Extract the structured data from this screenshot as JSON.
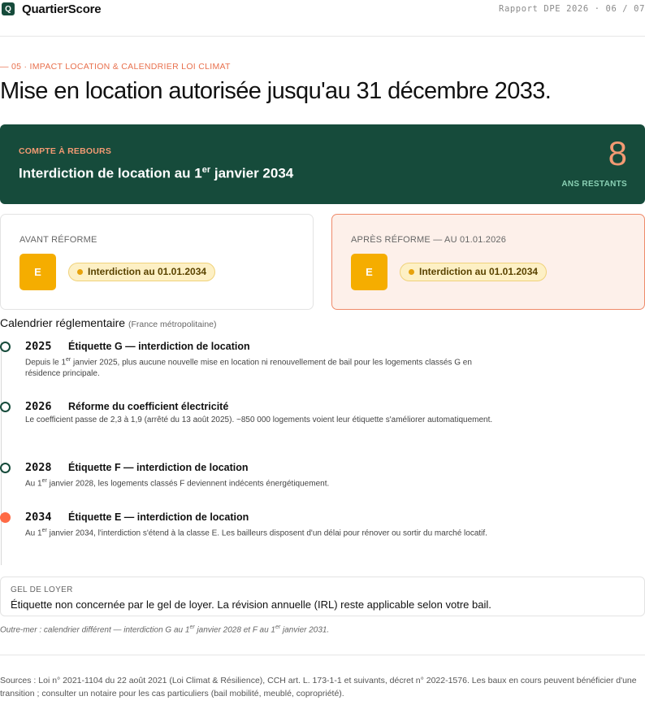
{
  "header": {
    "logo_letter": "Q",
    "brand": "QuartierScore",
    "report_ref": "Rapport DPE 2026 · 06 / 07"
  },
  "section": {
    "eyebrow": "— 05 · IMPACT LOCATION & CALENDRIER LOI CLIMAT",
    "title": "Mise en location autorisée jusqu'au 31 décembre 2033."
  },
  "countdown": {
    "label": "COMPTE À REBOURS",
    "title_before": "Interdiction de location au 1",
    "title_sup": "er",
    "title_after": " janvier 2034",
    "number": "8",
    "unit": "ANS RESTANTS",
    "colors": {
      "background": "#164b3b",
      "accent": "#f29a73"
    }
  },
  "before": {
    "label": "AVANT RÉFORME",
    "grade": "E",
    "pill": "Interdiction au 01.01.2034"
  },
  "after": {
    "label": "APRÈS RÉFORME — AU 01.01.2026",
    "grade": "E",
    "pill": "Interdiction au 01.01.2034"
  },
  "calendar": {
    "title": "Calendrier réglementaire",
    "subtitle": "(France métropolitaine)",
    "items": [
      {
        "year": "2025",
        "head": "Étiquette G — interdiction de location",
        "text_a": "Depuis le 1",
        "text_sup": "er",
        "text_b": " janvier 2025, plus aucune nouvelle mise en location ni renouvellement de bail pour les logements classés G en résidence principale."
      },
      {
        "year": "2026",
        "head": "Réforme du coefficient électricité",
        "text": "Le coefficient passe de 2,3 à 1,9 (arrêté du 13 août 2025). ~850 000 logements voient leur étiquette s'améliorer automatiquement."
      },
      {
        "year": "2028",
        "head": "Étiquette F — interdiction de location",
        "text_a": "Au 1",
        "text_sup": "er",
        "text_b": " janvier 2028, les logements classés F deviennent indécents énergétiquement."
      },
      {
        "year": "2034",
        "head": "Étiquette E — interdiction de location",
        "text_a": "Au 1",
        "text_sup": "er",
        "text_b": " janvier 2034, l'interdiction s'étend à la classe E. Les bailleurs disposent d'un délai pour rénover ou sortir du marché locatif."
      }
    ]
  },
  "gel": {
    "label": "GEL DE LOYER",
    "text": "Étiquette non concernée par le gel de loyer. La révision annuelle (IRL) reste applicable selon votre bail."
  },
  "outre_mer": {
    "a": "Outre-mer : calendrier différent — interdiction G au 1",
    "sup1": "er",
    "b": " janvier 2028 et F au 1",
    "sup2": "er",
    "c": " janvier 2031."
  },
  "sources": "Sources : Loi n° 2021-1104 du 22 août 2021 (Loi Climat & Résilience), CCH art. L. 173-1-1 et suivants, décret n° 2022-1576. Les baux en cours peuvent bénéficier d'une transition ; consulter un notaire pour les cas particuliers (bail mobilité, meublé, copropriété)."
}
